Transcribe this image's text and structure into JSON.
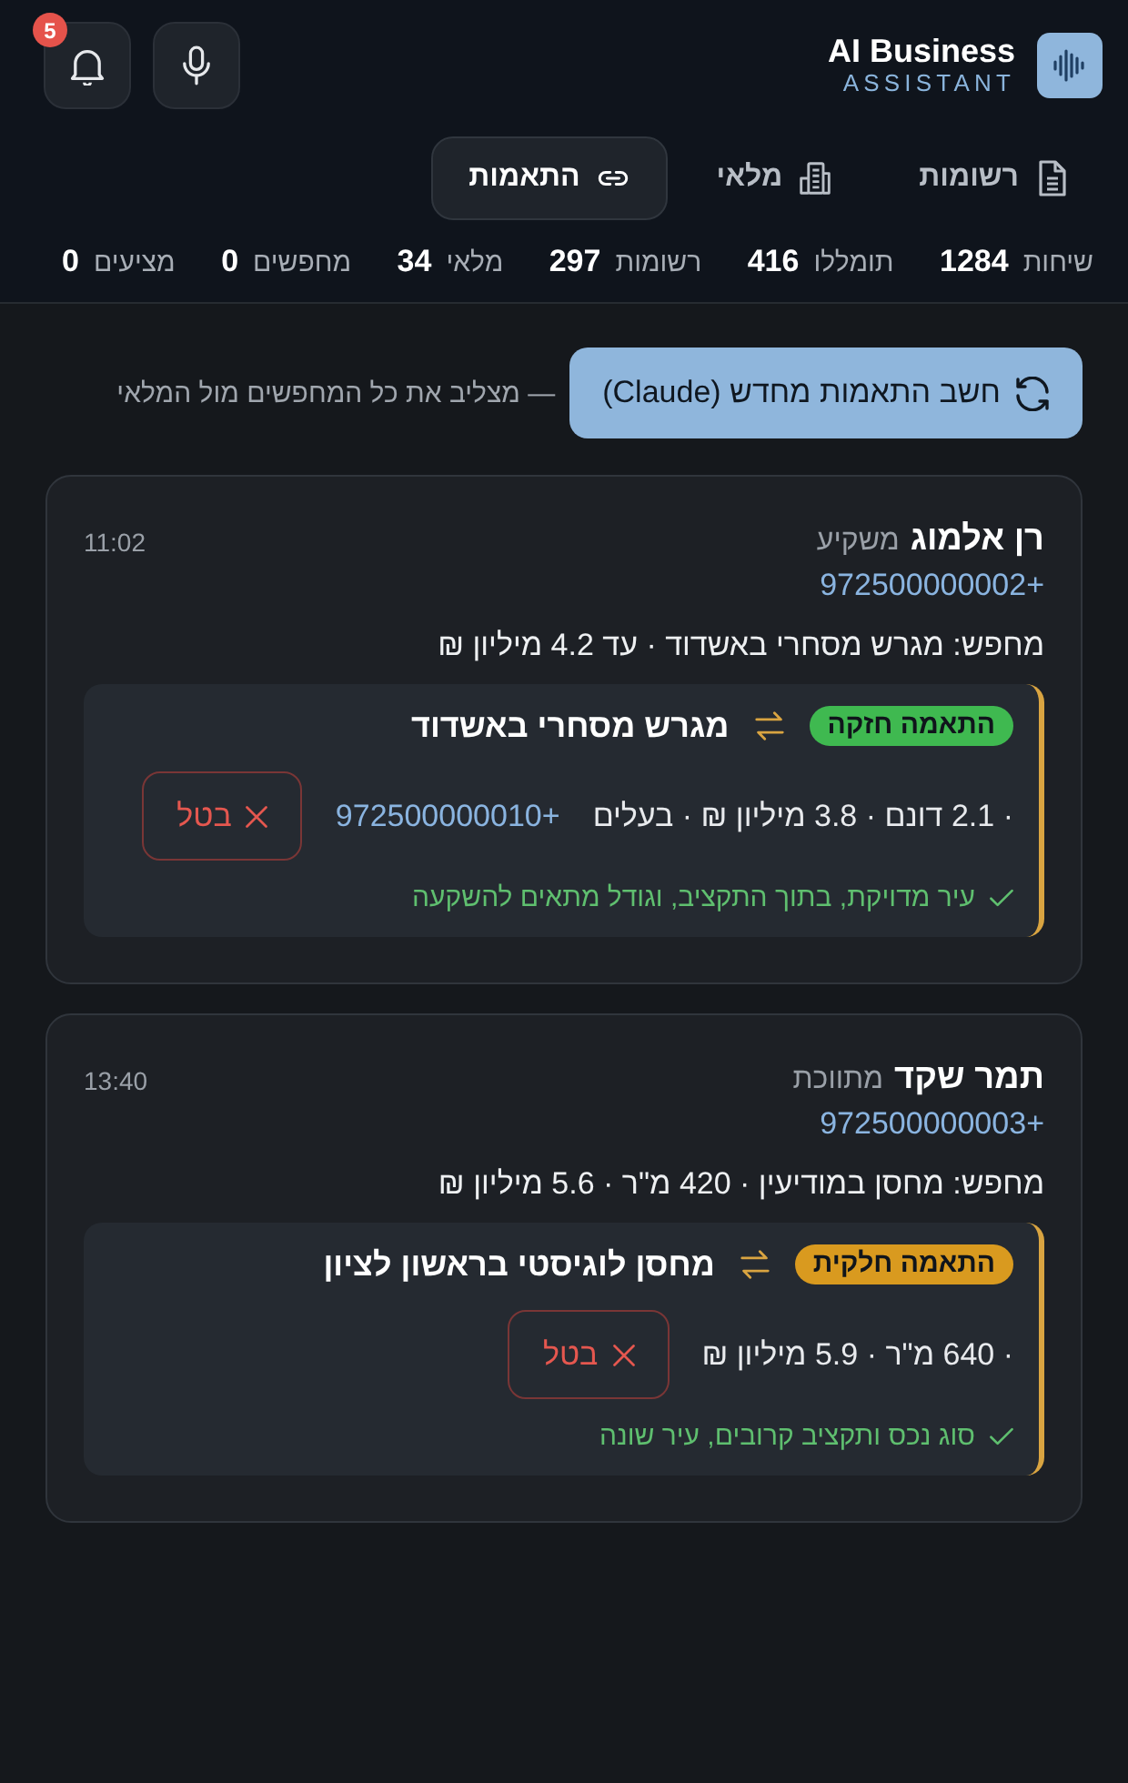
{
  "header": {
    "title": "AI Business",
    "subtitle": "ASSISTANT",
    "notifications": "5"
  },
  "tabs": [
    {
      "label": "רשומות",
      "selected": false
    },
    {
      "label": "מלאי",
      "selected": false
    },
    {
      "label": "התאמות",
      "selected": true
    }
  ],
  "stats": [
    {
      "label": "שיחות",
      "value": "1284"
    },
    {
      "label": "תומללו",
      "value": "416"
    },
    {
      "label": "רשומות",
      "value": "297"
    },
    {
      "label": "מלאי",
      "value": "34"
    },
    {
      "label": "מחפשים",
      "value": "0"
    },
    {
      "label": "מציעים",
      "value": "0"
    }
  ],
  "recalc": {
    "button": "חשב התאמות מחדש (Claude)",
    "note": "— מצליב את כל המחפשים מול המלאי"
  },
  "seekers": [
    {
      "name": "רן אלמוג",
      "role": "משקיע",
      "phone": "+972500000002",
      "time": "11:02",
      "request": "מחפש: מגרש מסחרי באשדוד · עד 4.2 מיליון ₪",
      "matches": [
        {
          "badge": "התאמה חזקה",
          "color": "#3fb950",
          "title": "מגרש מסחרי באשדוד",
          "details": "· 2.1 דונם · 3.8 מיליון ₪ · בעלים",
          "phone": "+972500000010",
          "cancel": "בטל",
          "reason": "עיר מדויקת, בתוך התקציב, וגודל מתאים להשקעה"
        }
      ]
    },
    {
      "name": "תמר שקד",
      "role": "מתווכת",
      "phone": "+972500000003",
      "time": "13:40",
      "request": "מחפש: מחסן במודיעין · 420 מ\"ר · 5.6 מיליון ₪",
      "matches": [
        {
          "badge": "התאמה חלקית",
          "color": "#d99a1f",
          "title": "מחסן לוגיסטי בראשון לציון",
          "details": "· 640 מ\"ר · 5.9 מיליון ₪",
          "cancel": "בטל",
          "reason": "סוג נכס ותקציב קרובים, עיר שונה"
        }
      ]
    }
  ]
}
